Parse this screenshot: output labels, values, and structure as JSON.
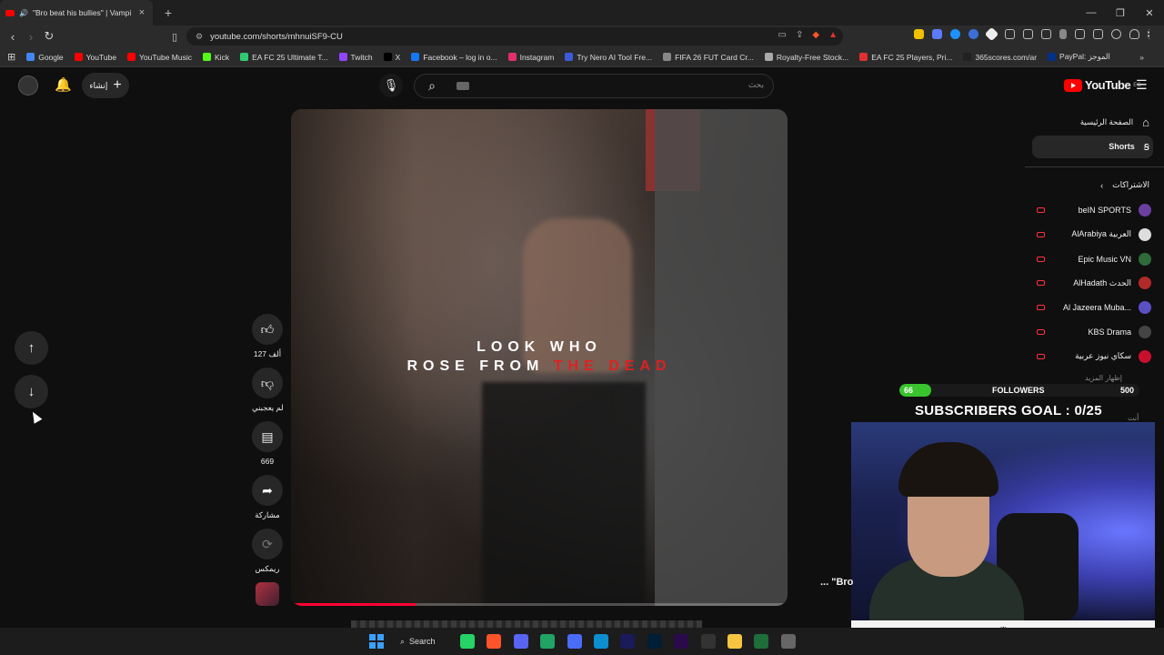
{
  "browser": {
    "tab_title": "\"Bro beat his bullies\" | Vampi",
    "new_tab": "+",
    "url": "youtube.com/shorts/mhnuiSF9-CU",
    "window_controls": [
      "—",
      "❐",
      "✕"
    ]
  },
  "bookmarks": [
    {
      "label": "Google",
      "color": "#4285f4"
    },
    {
      "label": "YouTube",
      "color": "#ff0000"
    },
    {
      "label": "YouTube Music",
      "color": "#ff0000"
    },
    {
      "label": "Kick",
      "color": "#53fc18"
    },
    {
      "label": "EA FC 25 Ultimate T...",
      "color": "#2ecc71"
    },
    {
      "label": "Twitch",
      "color": "#9146ff"
    },
    {
      "label": "X",
      "color": "#000000"
    },
    {
      "label": "Facebook – log in o...",
      "color": "#1877f2"
    },
    {
      "label": "Instagram",
      "color": "#e1306c"
    },
    {
      "label": "Try Nero AI Tool Fre...",
      "color": "#3b5bdb"
    },
    {
      "label": "FIFA 26 FUT Card Cr...",
      "color": "#888888"
    },
    {
      "label": "Royalty-Free Stock...",
      "color": "#aaaaaa"
    },
    {
      "label": "EA FC 25 Players, Pri...",
      "color": "#e03131"
    },
    {
      "label": "365scores.com/ar",
      "color": "#222222"
    },
    {
      "label": "PayPal: الموجز",
      "color": "#003087"
    }
  ],
  "header": {
    "create_label": "إنشاء",
    "search_placeholder": "بحث",
    "logo_text": "YouTube",
    "logo_region": "EG"
  },
  "video": {
    "line1": "LOOK WHO",
    "line2_white": "ROSE FROM",
    "line2_red": "THE DEAD",
    "progress_fraction": 0.25
  },
  "actions": {
    "like_count": "127 ألف",
    "dislike_label": "لم يعجبني",
    "comments_count": "669",
    "share_label": "مشاركة",
    "remix_label": "ريمكس"
  },
  "sidebar": {
    "home_label": "الصفحة الرئيسية",
    "shorts_label": "Shorts",
    "subscriptions_label": "الاشتراكات",
    "show_more_label": "إظهار المزيد",
    "you_label": "أنت",
    "subscriptions": [
      {
        "name": "beIN SPORTS",
        "color": "#6b3fa0"
      },
      {
        "name": "AlArabiya العربية",
        "color": "#dddddd"
      },
      {
        "name": "Epic Music VN",
        "color": "#2f6b3a"
      },
      {
        "name": "AlHadath الحدث",
        "color": "#b02a2a"
      },
      {
        "name": "Al Jazeera Muba...",
        "color": "#5b4fc4"
      },
      {
        "name": "KBS Drama",
        "color": "#444444"
      },
      {
        "name": "سكاي نيوز عربية",
        "color": "#c8102e"
      }
    ]
  },
  "overlay": {
    "followers_current": "66",
    "followers_label": "FOLLOWERS",
    "followers_goal": "500",
    "followers_fraction": 0.132,
    "subscribers_goal_text": "SUBSCRIBERS GOAL : 0/25",
    "caption_fragment": "... \"Bro"
  },
  "taskbar": {
    "search_label": "Search",
    "apps": [
      {
        "name": "whatsapp",
        "color": "#25d366"
      },
      {
        "name": "brave",
        "color": "#fb542b"
      },
      {
        "name": "discord",
        "color": "#5865f2"
      },
      {
        "name": "excel-like",
        "color": "#21a366"
      },
      {
        "name": "calculator",
        "color": "#4a6cf7"
      },
      {
        "name": "edge",
        "color": "#0c8ecf"
      },
      {
        "name": "after-effects",
        "color": "#1a1a5a"
      },
      {
        "name": "photoshop",
        "color": "#001e36"
      },
      {
        "name": "audition",
        "color": "#2a0a4a"
      },
      {
        "name": "obs",
        "color": "#333333"
      },
      {
        "name": "files",
        "color": "#f5c542"
      },
      {
        "name": "terminal",
        "color": "#1e6e3a"
      },
      {
        "name": "settings",
        "color": "#666666"
      }
    ]
  }
}
